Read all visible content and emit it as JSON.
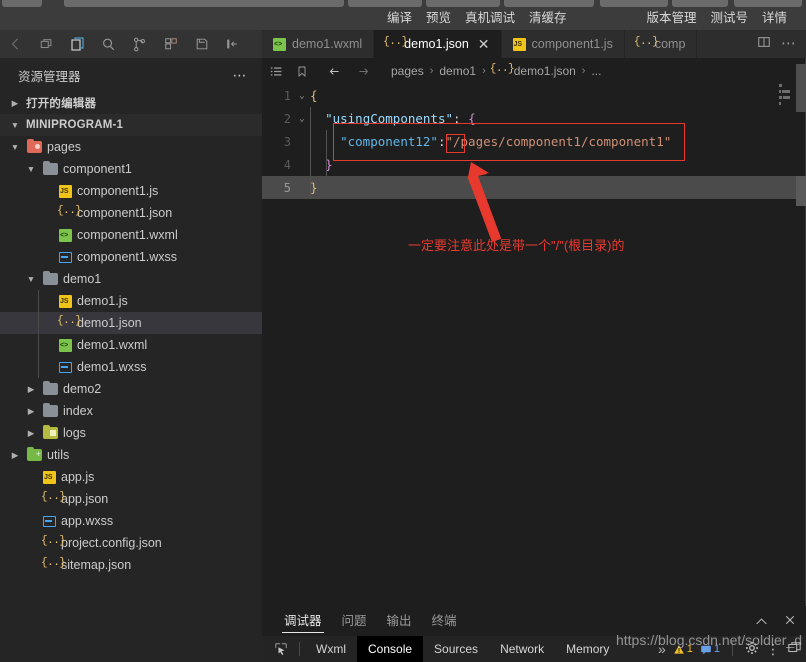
{
  "menubar": {
    "center_items": [
      "编译",
      "预览",
      "真机调试",
      "清缓存"
    ],
    "right_items": [
      "版本管理",
      "测试号",
      "详情"
    ]
  },
  "activity_icons": [
    {
      "name": "back-arrow-icon"
    },
    {
      "name": "window-restore-icon"
    },
    {
      "name": "explorer-files-icon"
    },
    {
      "name": "search-icon"
    },
    {
      "name": "source-control-icon"
    },
    {
      "name": "extensions-icon"
    },
    {
      "name": "save-icon"
    },
    {
      "name": "toggle-sidebar-icon"
    }
  ],
  "tabs": [
    {
      "label": "demo1.wxml",
      "icon": "wxml",
      "active": false,
      "closable": false
    },
    {
      "label": "demo1.json",
      "icon": "json",
      "active": true,
      "closable": true,
      "close_glyph": "✕"
    },
    {
      "label": "component1.js",
      "icon": "js",
      "active": false,
      "closable": false
    },
    {
      "label": "comp",
      "icon": "json",
      "active": false,
      "closable": false
    }
  ],
  "tabs_right": {
    "split_editor": "split-editor-icon",
    "more": "⋯"
  },
  "sidebar": {
    "title": "资源管理器",
    "title_more": "⋯",
    "open_editors_label": "打开的编辑器",
    "project_label": "MINIPROGRAM-1",
    "tree": [
      {
        "label": "pages",
        "type": "folder",
        "folder_color": "red",
        "depth": 1,
        "expanded": true
      },
      {
        "label": "component1",
        "type": "folder",
        "folder_color": "grey",
        "depth": 2,
        "expanded": true
      },
      {
        "label": "component1.js",
        "type": "js",
        "depth": 3
      },
      {
        "label": "component1.json",
        "type": "json",
        "depth": 3
      },
      {
        "label": "component1.wxml",
        "type": "wxml",
        "depth": 3
      },
      {
        "label": "component1.wxss",
        "type": "wxss",
        "depth": 3
      },
      {
        "label": "demo1",
        "type": "folder",
        "folder_color": "grey",
        "depth": 2,
        "expanded": true
      },
      {
        "label": "demo1.js",
        "type": "js",
        "depth": 3
      },
      {
        "label": "demo1.json",
        "type": "json",
        "depth": 3,
        "selected": true
      },
      {
        "label": "demo1.wxml",
        "type": "wxml",
        "depth": 3
      },
      {
        "label": "demo1.wxss",
        "type": "wxss",
        "depth": 3
      },
      {
        "label": "demo2",
        "type": "folder",
        "folder_color": "grey",
        "depth": 2,
        "expanded": false
      },
      {
        "label": "index",
        "type": "folder",
        "folder_color": "grey",
        "depth": 2,
        "expanded": false
      },
      {
        "label": "logs",
        "type": "folder",
        "folder_color": "olive",
        "depth": 2,
        "expanded": false
      },
      {
        "label": "utils",
        "type": "folder",
        "folder_color": "green",
        "depth": 1,
        "expanded": false
      },
      {
        "label": "app.js",
        "type": "js",
        "depth": 2
      },
      {
        "label": "app.json",
        "type": "json",
        "depth": 2
      },
      {
        "label": "app.wxss",
        "type": "wxss",
        "depth": 2
      },
      {
        "label": "project.config.json",
        "type": "json",
        "depth": 2
      },
      {
        "label": "sitemap.json",
        "type": "json",
        "depth": 2
      }
    ]
  },
  "breadcrumbs": {
    "icons": [
      "outline-icon",
      "bookmark-icon",
      "arrow-left-icon",
      "arrow-right-icon"
    ],
    "items": [
      "pages",
      "demo1",
      "demo1.json",
      "..."
    ],
    "separator": "›"
  },
  "code": {
    "lines": [
      {
        "num": "1",
        "fold": "⌄",
        "segments": [
          {
            "t": "{",
            "c": "tk-brace"
          }
        ]
      },
      {
        "num": "2",
        "fold": "⌄",
        "segments": [
          {
            "t": "  ",
            "c": "tk-punc"
          },
          {
            "t": "\"usingComponents\"",
            "c": "tk-key"
          },
          {
            "t": ": ",
            "c": "tk-punc"
          },
          {
            "t": "{",
            "c": "tk-brace2"
          }
        ]
      },
      {
        "num": "3",
        "fold": "",
        "segments": [
          {
            "t": "    ",
            "c": "tk-punc"
          },
          {
            "t": "\"component12\"",
            "c": "tk-key2"
          },
          {
            "t": ":",
            "c": "tk-punc"
          },
          {
            "t": "\"/pages/component1/component1\"",
            "c": "tk-str"
          }
        ]
      },
      {
        "num": "4",
        "fold": "",
        "segments": [
          {
            "t": "  ",
            "c": "tk-punc"
          },
          {
            "t": "}",
            "c": "tk-brace2"
          }
        ]
      },
      {
        "num": "5",
        "fold": "",
        "active": true,
        "segments": [
          {
            "t": "}",
            "c": "tk-brace"
          }
        ]
      }
    ]
  },
  "annotation": {
    "text": "一定要注意此处是带一个\"/\"(根目录)的",
    "color": "#e8392e"
  },
  "panel": {
    "tabs": [
      {
        "label": "调试器",
        "active": true
      },
      {
        "label": "问题",
        "active": false
      },
      {
        "label": "输出",
        "active": false
      },
      {
        "label": "终端",
        "active": false
      }
    ],
    "actions": {
      "collapse": "⌃",
      "close": "✕"
    }
  },
  "devtools": {
    "inspect_icon": "inspect-element-icon",
    "tabs": [
      {
        "label": "Wxml",
        "active": false
      },
      {
        "label": "Console",
        "active": true
      },
      {
        "label": "Sources",
        "active": false
      },
      {
        "label": "Network",
        "active": false
      },
      {
        "label": "Memory",
        "active": false
      }
    ],
    "overflow": "»",
    "warning_count": "1",
    "info_count": "1",
    "gear_icon": "gear-icon",
    "more_icon": "more-vertical-icon",
    "dock_icon": "dock-side-icon"
  },
  "watermark": "https://blog.csdn.net/soldier_d"
}
